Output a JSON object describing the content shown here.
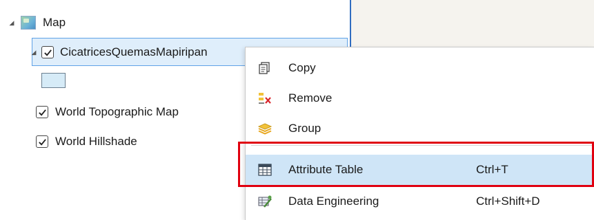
{
  "contents": {
    "map_label": "Map",
    "layer_label": "CicatricesQuemasMapiripan",
    "basemaps": [
      {
        "label": "World Topographic Map",
        "checked": true
      },
      {
        "label": "World Hillshade",
        "checked": true
      }
    ]
  },
  "menu": {
    "items": [
      {
        "icon": "copy-icon",
        "label": "Copy",
        "shortcut": ""
      },
      {
        "icon": "remove-icon",
        "label": "Remove",
        "shortcut": ""
      },
      {
        "icon": "group-icon",
        "label": "Group",
        "shortcut": ""
      },
      {
        "icon": "table-icon",
        "label": "Attribute Table",
        "shortcut": "Ctrl+T"
      },
      {
        "icon": "data-engineering-icon",
        "label": "Data Engineering",
        "shortcut": "Ctrl+Shift+D"
      }
    ]
  },
  "colors": {
    "selection": "#dfeefb",
    "hover": "#cfe5f7",
    "annotation": "#e0000f"
  }
}
